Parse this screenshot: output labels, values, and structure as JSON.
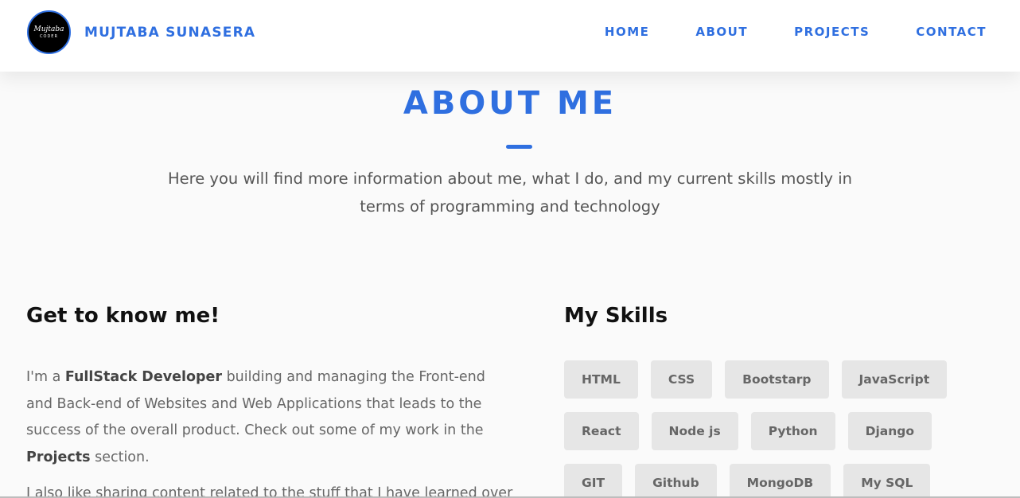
{
  "header": {
    "logo": {
      "script_text": "Mujtaba",
      "sub_text": "CODER"
    },
    "brand": "MUJTABA SUNASERA",
    "nav": [
      "HOME",
      "ABOUT",
      "PROJECTS",
      "CONTACT"
    ]
  },
  "about": {
    "title": "ABOUT ME",
    "subtitle": "Here you will find more information about me, what I do, and my current skills mostly in terms of programming and technology"
  },
  "intro": {
    "heading": "Get to know me!",
    "p1_a": "I'm a ",
    "p1_b": "FullStack Developer",
    "p1_c": " building and managing the Front-end and Back-end of Websites and Web Applications that leads to the success of the overall product. Check out some of my work in the ",
    "p1_d": "Projects",
    "p1_e": " section.",
    "p2": "I also like sharing content related to the stuff that I have learned over"
  },
  "skills": {
    "heading": "My Skills",
    "items": [
      "HTML",
      "CSS",
      "Bootstarp",
      "JavaScript",
      "React",
      "Node js",
      "Python",
      "Django",
      "GIT",
      "Github",
      "MongoDB",
      "My SQL"
    ]
  },
  "colors": {
    "accent": "#2f6fe0",
    "chip": "#e6e6e6",
    "background": "#fafafa"
  }
}
